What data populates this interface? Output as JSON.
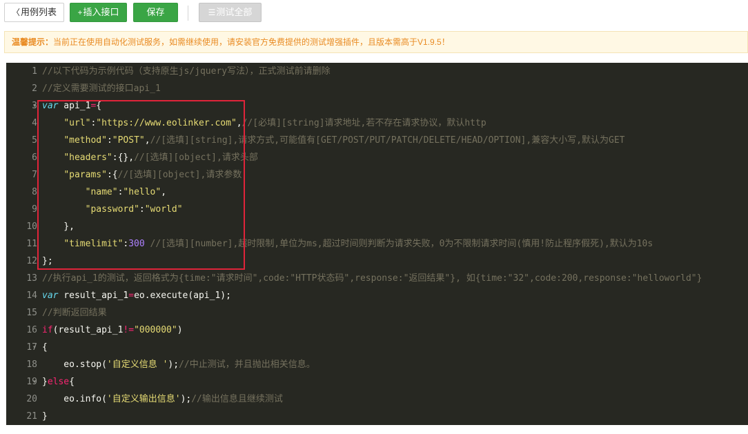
{
  "toolbar": {
    "back_label": "用例列表",
    "insert_label": "插入接口",
    "save_label": "保存",
    "test_all_label": "测试全部"
  },
  "notice": {
    "title": "温馨提示：",
    "text": "当前正在使用自动化测试服务，如需继续使用，请安装官方免费提供的测试增强插件，且版本需高于V1.9.5！"
  },
  "editor": {
    "lines": [
      {
        "num": "1",
        "text": "//以下代码为示例代码（支持原生js/jquery写法），正式测试前请删除"
      },
      {
        "num": "2",
        "text": "//定义需要测试的接口api_1"
      },
      {
        "num": "3",
        "text": "var api_1={"
      },
      {
        "num": "4",
        "text": "    \"url\":\"https://www.eolinker.com\",//[必填][string]请求地址,若不存在请求协议，默认http"
      },
      {
        "num": "5",
        "text": "    \"method\":\"POST\",//[选填][string],请求方式,可能值有[GET/POST/PUT/PATCH/DELETE/HEAD/OPTION],兼容大小写,默认为GET"
      },
      {
        "num": "6",
        "text": "    \"headers\":{},//[选填][object],请求头部"
      },
      {
        "num": "7",
        "text": "    \"params\":{//[选填][object],请求参数"
      },
      {
        "num": "8",
        "text": "        \"name\":\"hello\","
      },
      {
        "num": "9",
        "text": "        \"password\":\"world\""
      },
      {
        "num": "10",
        "text": "    },"
      },
      {
        "num": "11",
        "text": "    \"timelimit\":300 //[选填][number],超时限制,单位为ms,超过时间则判断为请求失败，0为不限制请求时间(慎用!防止程序假死),默认为10s"
      },
      {
        "num": "12",
        "text": "};"
      },
      {
        "num": "13",
        "text": "//执行api_1的测试，返回格式为{time:\"请求时间\",code:\"HTTP状态码\",response:\"返回结果\"}, 如{time:\"32\",code:200,response:\"helloworld\"}"
      },
      {
        "num": "14",
        "text": "var result_api_1=eo.execute(api_1);"
      },
      {
        "num": "15",
        "text": "//判断返回结果"
      },
      {
        "num": "16",
        "text": "if(result_api_1!=\"000000\")"
      },
      {
        "num": "17",
        "text": "{"
      },
      {
        "num": "18",
        "text": "    eo.stop('自定义信息 ');//中止测试，并且抛出相关信息。"
      },
      {
        "num": "19",
        "text": "}else{"
      },
      {
        "num": "20",
        "text": "    eo.info('自定义输出信息');//输出信息且继续测试"
      },
      {
        "num": "21",
        "text": "}"
      }
    ]
  },
  "colors": {
    "editor_bg": "#272822",
    "accent_green": "#3aa545",
    "highlight_border": "#e0243a",
    "notice_text": "#e98b23"
  }
}
